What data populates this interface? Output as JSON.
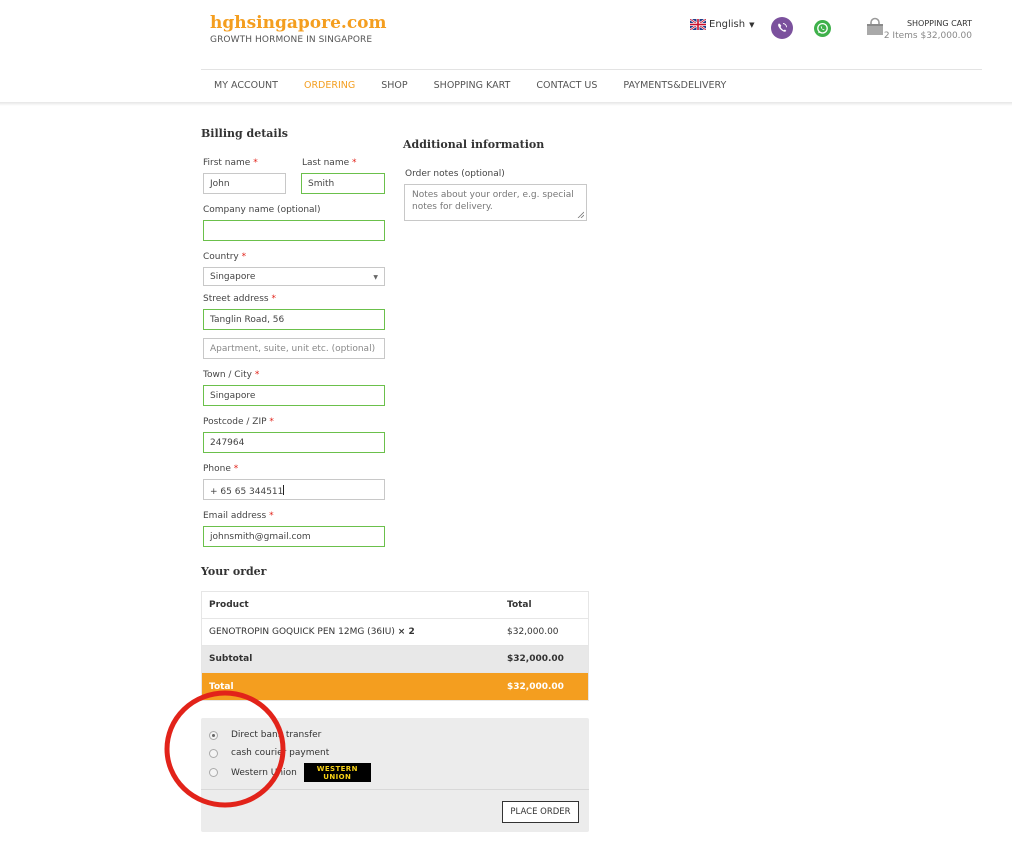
{
  "brand": {
    "title": "hghsingapore.com",
    "subtitle": "GROWTH HORMONE IN SINGAPORE"
  },
  "header": {
    "language": "English",
    "cart_title": "SHOPPING CART",
    "cart_info": "2 Items $32,000.00"
  },
  "nav": [
    "MY ACCOUNT",
    "ORDERING",
    "SHOP",
    "SHOPPING KART",
    "CONTACT US",
    "PAYMENTS&DELIVERY"
  ],
  "billing": {
    "heading": "Billing details",
    "first_name_label": "First name",
    "first_name": "John",
    "last_name_label": "Last name",
    "last_name": "Smith",
    "company_label": "Company name (optional)",
    "company": "",
    "country_label": "Country",
    "country": "Singapore",
    "street_label": "Street address",
    "street": "Tanglin Road, 56",
    "apartment_placeholder": "Apartment, suite, unit etc. (optional)",
    "city_label": "Town / City",
    "city": "Singapore",
    "postcode_label": "Postcode / ZIP",
    "postcode": "247964",
    "phone_label": "Phone",
    "phone": "+ 65 65 344511",
    "email_label": "Email address",
    "email": "johnsmith@gmail.com",
    "required_mark": "*"
  },
  "additional": {
    "heading": "Additional information",
    "notes_label": "Order notes (optional)",
    "notes_placeholder": "Notes about your order, e.g. special notes for delivery."
  },
  "order": {
    "heading": "Your order",
    "col_product": "Product",
    "col_total": "Total",
    "item_name": "GENOTROPIN GOQUICK PEN 12MG (36IU)",
    "item_qty": "× 2",
    "item_total": "$32,000.00",
    "subtotal_label": "Subtotal",
    "subtotal": "$32,000.00",
    "total_label": "Total",
    "total": "$32,000.00"
  },
  "payment": {
    "options": [
      "Direct bank transfer",
      "cash courier payment",
      "Western Union"
    ],
    "selected": "Direct bank transfer",
    "logo_text": "WESTERN UNION",
    "place_order": "PLACE ORDER"
  },
  "colors": {
    "accent": "#f49e1f",
    "field_border": "#6bc04b",
    "annotation": "#e2231a"
  }
}
